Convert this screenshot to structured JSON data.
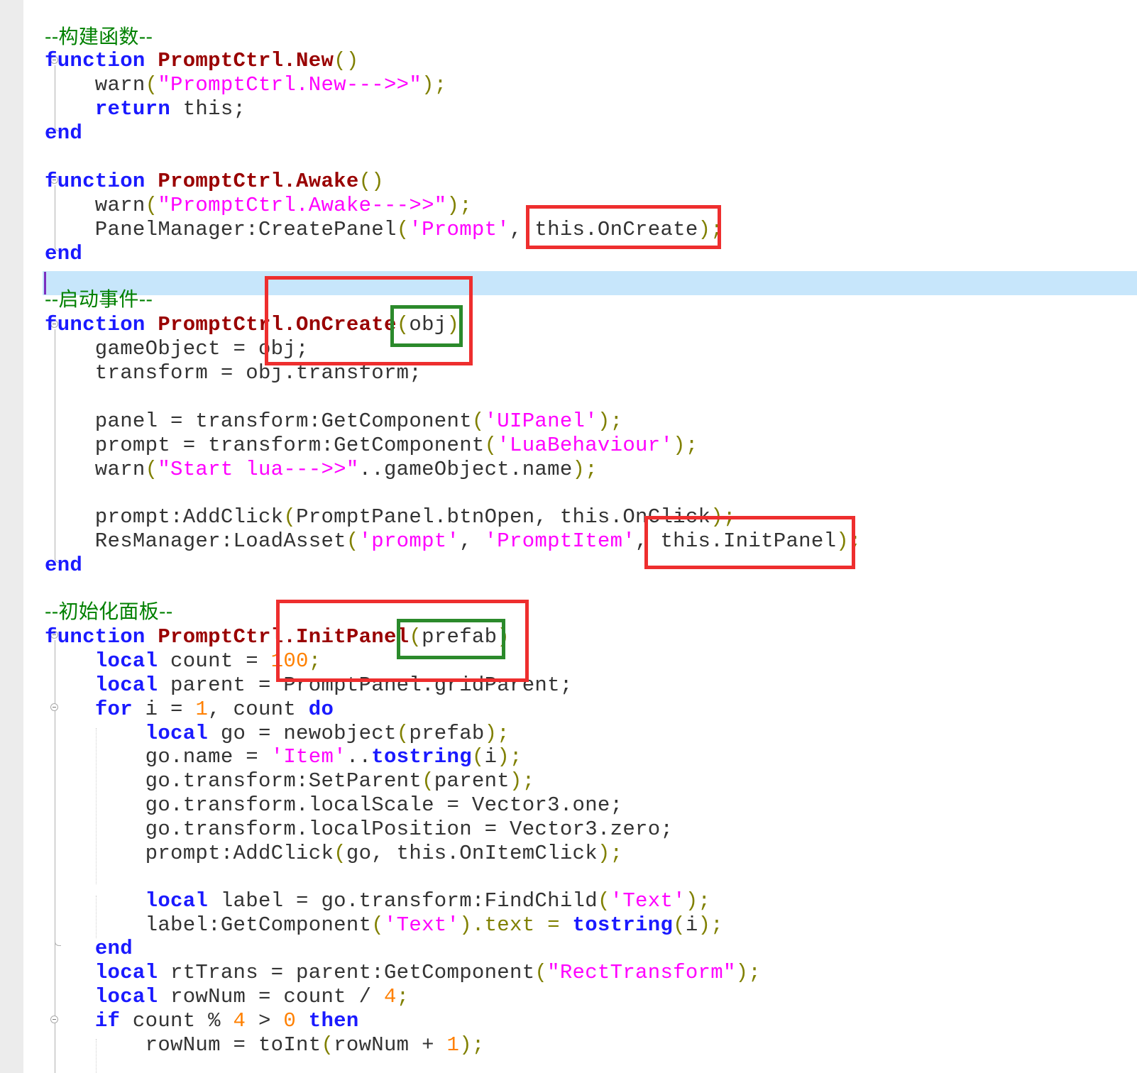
{
  "editor": {
    "language": "Lua",
    "colors": {
      "keyword": "#1a1aff",
      "function_name": "#990000",
      "string": "#ff00ff",
      "number": "#ff8000",
      "comment": "#008000",
      "current_line": "#c7e6fb",
      "annotation_red": "#ee2e2e",
      "annotation_green": "#2b8a2b"
    },
    "lines": [
      [
        {
          "t": "--构建函数--",
          "c": "cmt"
        }
      ],
      [
        {
          "t": "function",
          "c": "kw"
        },
        {
          "t": " "
        },
        {
          "t": "PromptCtrl.New",
          "c": "fn"
        },
        {
          "t": "()",
          "c": "pu"
        }
      ],
      [
        {
          "t": "    warn"
        },
        {
          "t": "(",
          "c": "pu"
        },
        {
          "t": "\"PromptCtrl.New--->>\"",
          "c": "str"
        },
        {
          "t": ")",
          "c": "pu"
        },
        {
          "t": ";",
          "c": "pu"
        }
      ],
      [
        {
          "t": "    "
        },
        {
          "t": "return",
          "c": "kw"
        },
        {
          "t": " this;"
        }
      ],
      [
        {
          "t": "end",
          "c": "kw"
        }
      ],
      [
        {
          "t": ""
        }
      ],
      [
        {
          "t": "function",
          "c": "kw"
        },
        {
          "t": " "
        },
        {
          "t": "PromptCtrl.Awake",
          "c": "fn"
        },
        {
          "t": "()",
          "c": "pu"
        }
      ],
      [
        {
          "t": "    warn"
        },
        {
          "t": "(",
          "c": "pu"
        },
        {
          "t": "\"PromptCtrl.Awake--->>\"",
          "c": "str"
        },
        {
          "t": ")",
          "c": "pu"
        },
        {
          "t": ";",
          "c": "pu"
        }
      ],
      [
        {
          "t": "    PanelManager:CreatePanel"
        },
        {
          "t": "(",
          "c": "pu"
        },
        {
          "t": "'Prompt'",
          "c": "str"
        },
        {
          "t": ", this.OnCreate"
        },
        {
          "t": ");",
          "c": "pu"
        }
      ],
      [
        {
          "t": "end",
          "c": "kw"
        }
      ],
      [
        {
          "t": ""
        }
      ],
      [
        {
          "t": "--启动事件--",
          "c": "cmt"
        }
      ],
      [
        {
          "t": "function",
          "c": "kw"
        },
        {
          "t": " "
        },
        {
          "t": "PromptCtrl.OnCreate",
          "c": "fn"
        },
        {
          "t": "(",
          "c": "pu"
        },
        {
          "t": "obj"
        },
        {
          "t": ")",
          "c": "pu"
        }
      ],
      [
        {
          "t": "    gameObject = obj;"
        }
      ],
      [
        {
          "t": "    transform = obj.transform;"
        }
      ],
      [
        {
          "t": ""
        }
      ],
      [
        {
          "t": "    panel = transform:GetComponent"
        },
        {
          "t": "(",
          "c": "pu"
        },
        {
          "t": "'UIPanel'",
          "c": "str"
        },
        {
          "t": ");",
          "c": "pu"
        }
      ],
      [
        {
          "t": "    prompt = transform:GetComponent"
        },
        {
          "t": "(",
          "c": "pu"
        },
        {
          "t": "'LuaBehaviour'",
          "c": "str"
        },
        {
          "t": ");",
          "c": "pu"
        }
      ],
      [
        {
          "t": "    warn"
        },
        {
          "t": "(",
          "c": "pu"
        },
        {
          "t": "\"Start lua--->>\"",
          "c": "str"
        },
        {
          "t": "..gameObject.name"
        },
        {
          "t": ");",
          "c": "pu"
        }
      ],
      [
        {
          "t": ""
        }
      ],
      [
        {
          "t": "    prompt:AddClick"
        },
        {
          "t": "(",
          "c": "pu"
        },
        {
          "t": "PromptPanel.btnOpen, this.OnClick"
        },
        {
          "t": ");",
          "c": "pu"
        }
      ],
      [
        {
          "t": "    ResManager:LoadAsset"
        },
        {
          "t": "(",
          "c": "pu"
        },
        {
          "t": "'prompt'",
          "c": "str"
        },
        {
          "t": ", "
        },
        {
          "t": "'PromptItem'",
          "c": "str"
        },
        {
          "t": ", this.InitPanel"
        },
        {
          "t": ");",
          "c": "pu"
        }
      ],
      [
        {
          "t": "end",
          "c": "kw"
        }
      ],
      [
        {
          "t": ""
        }
      ],
      [
        {
          "t": "--初始化面板--",
          "c": "cmt"
        }
      ],
      [
        {
          "t": "function",
          "c": "kw"
        },
        {
          "t": " "
        },
        {
          "t": "PromptCtrl.InitPanel",
          "c": "fn"
        },
        {
          "t": "(",
          "c": "pu"
        },
        {
          "t": "prefab"
        },
        {
          "t": ")",
          "c": "pu"
        }
      ],
      [
        {
          "t": "    "
        },
        {
          "t": "local",
          "c": "kw"
        },
        {
          "t": " count = "
        },
        {
          "t": "100",
          "c": "num"
        },
        {
          "t": ";",
          "c": "pu"
        }
      ],
      [
        {
          "t": "    "
        },
        {
          "t": "local",
          "c": "kw"
        },
        {
          "t": " parent = PromptPanel.gridParent;"
        }
      ],
      [
        {
          "t": "    "
        },
        {
          "t": "for",
          "c": "kw"
        },
        {
          "t": " i = "
        },
        {
          "t": "1",
          "c": "num"
        },
        {
          "t": ", count "
        },
        {
          "t": "do",
          "c": "kw"
        }
      ],
      [
        {
          "t": "        "
        },
        {
          "t": "local",
          "c": "kw"
        },
        {
          "t": " go = newobject"
        },
        {
          "t": "(",
          "c": "pu"
        },
        {
          "t": "prefab"
        },
        {
          "t": ");",
          "c": "pu"
        }
      ],
      [
        {
          "t": "        go.name = "
        },
        {
          "t": "'Item'",
          "c": "str"
        },
        {
          "t": ".."
        },
        {
          "t": "tostring",
          "c": "kw"
        },
        {
          "t": "(",
          "c": "pu"
        },
        {
          "t": "i"
        },
        {
          "t": ");",
          "c": "pu"
        }
      ],
      [
        {
          "t": "        go.transform:SetParent"
        },
        {
          "t": "(",
          "c": "pu"
        },
        {
          "t": "parent"
        },
        {
          "t": ");",
          "c": "pu"
        }
      ],
      [
        {
          "t": "        go.transform.localScale = Vector3.one;"
        }
      ],
      [
        {
          "t": "        go.transform.localPosition = Vector3.zero;"
        }
      ],
      [
        {
          "t": "        prompt:AddClick"
        },
        {
          "t": "(",
          "c": "pu"
        },
        {
          "t": "go, this.OnItemClick"
        },
        {
          "t": ");",
          "c": "pu"
        }
      ],
      [
        {
          "t": ""
        }
      ],
      [
        {
          "t": "        "
        },
        {
          "t": "local",
          "c": "kw"
        },
        {
          "t": " label = go.transform:FindChild"
        },
        {
          "t": "(",
          "c": "pu"
        },
        {
          "t": "'Text'",
          "c": "str"
        },
        {
          "t": ");",
          "c": "pu"
        }
      ],
      [
        {
          "t": "        label:GetComponent"
        },
        {
          "t": "(",
          "c": "pu"
        },
        {
          "t": "'Text'",
          "c": "str"
        },
        {
          "t": ").text = ",
          "c": "pu"
        },
        {
          "t": "tostring",
          "c": "kw"
        },
        {
          "t": "(",
          "c": "pu"
        },
        {
          "t": "i"
        },
        {
          "t": ");",
          "c": "pu"
        }
      ],
      [
        {
          "t": "    "
        },
        {
          "t": "end",
          "c": "kw"
        }
      ],
      [
        {
          "t": "    "
        },
        {
          "t": "local",
          "c": "kw"
        },
        {
          "t": " rtTrans = parent:GetComponent"
        },
        {
          "t": "(",
          "c": "pu"
        },
        {
          "t": "\"RectTransform\"",
          "c": "str"
        },
        {
          "t": ");",
          "c": "pu"
        }
      ],
      [
        {
          "t": "    "
        },
        {
          "t": "local",
          "c": "kw"
        },
        {
          "t": " rowNum = count / "
        },
        {
          "t": "4",
          "c": "num"
        },
        {
          "t": ";",
          "c": "pu"
        }
      ],
      [
        {
          "t": "    "
        },
        {
          "t": "if",
          "c": "kw"
        },
        {
          "t": " count % "
        },
        {
          "t": "4",
          "c": "num"
        },
        {
          "t": " > "
        },
        {
          "t": "0",
          "c": "num"
        },
        {
          "t": " "
        },
        {
          "t": "then",
          "c": "kw"
        }
      ],
      [
        {
          "t": "        rowNum = toInt"
        },
        {
          "t": "(",
          "c": "pu"
        },
        {
          "t": "rowNum + "
        },
        {
          "t": "1",
          "c": "num"
        },
        {
          "t": ");",
          "c": "pu"
        }
      ]
    ]
  }
}
